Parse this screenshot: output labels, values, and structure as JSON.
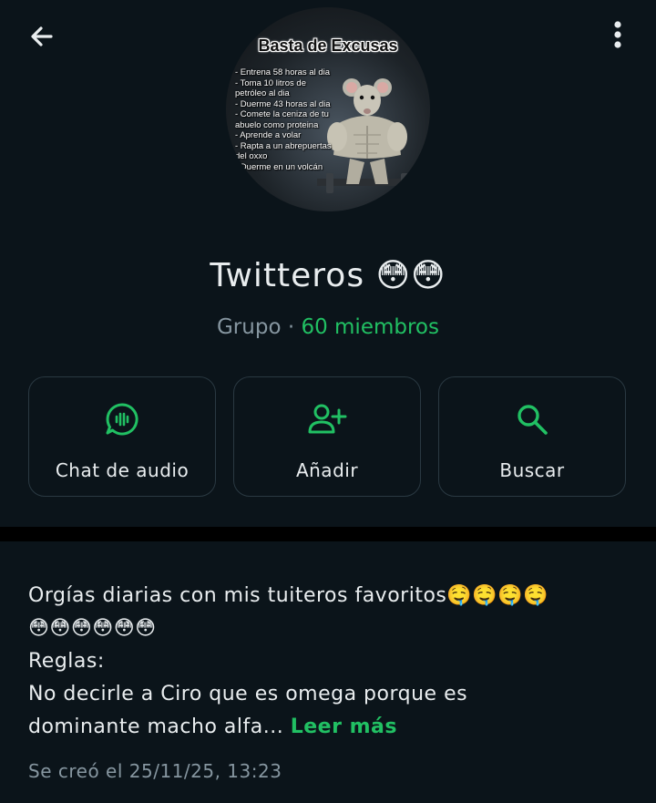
{
  "header": {
    "back_icon": "arrow-left-icon",
    "menu_icon": "more-vertical-icon"
  },
  "avatar": {
    "banner": "Basta de Excusas",
    "list": [
      "- Entrena 58 horas al dia",
      "- Toma 10 litros de",
      "petróleo al dia",
      "- Duerme 43 horas al dia",
      "- Comete la ceniza de tu",
      "abuelo como proteina",
      "- Aprende a volar",
      "- Rapta a un abrepuertas",
      "del oxxo",
      "- Duerme en un volcán"
    ]
  },
  "group": {
    "name": "Twitteros 😳😳",
    "kind": "Grupo",
    "separator": "·",
    "members": "60 miembros"
  },
  "actions": [
    {
      "label": "Chat de audio",
      "icon": "audio-chat-icon"
    },
    {
      "label": "Añadir",
      "icon": "add-person-icon"
    },
    {
      "label": "Buscar",
      "icon": "search-icon"
    }
  ],
  "description": {
    "line1": "Orgías diarias con mis tuiteros favoritos🤤🤤🤤🤤",
    "line2": "😳😳😳😳😳😳",
    "line3": "Reglas:",
    "line4": "No decirle a Ciro que es omega porque es",
    "line5": "dominante macho alfa...",
    "read_more": "Leer más",
    "created": "Se creó el 25/11/25, 13:23"
  },
  "colors": {
    "background": "#0b141a",
    "accent": "#21c063",
    "muted": "#8696a0",
    "border": "#2a3942"
  }
}
